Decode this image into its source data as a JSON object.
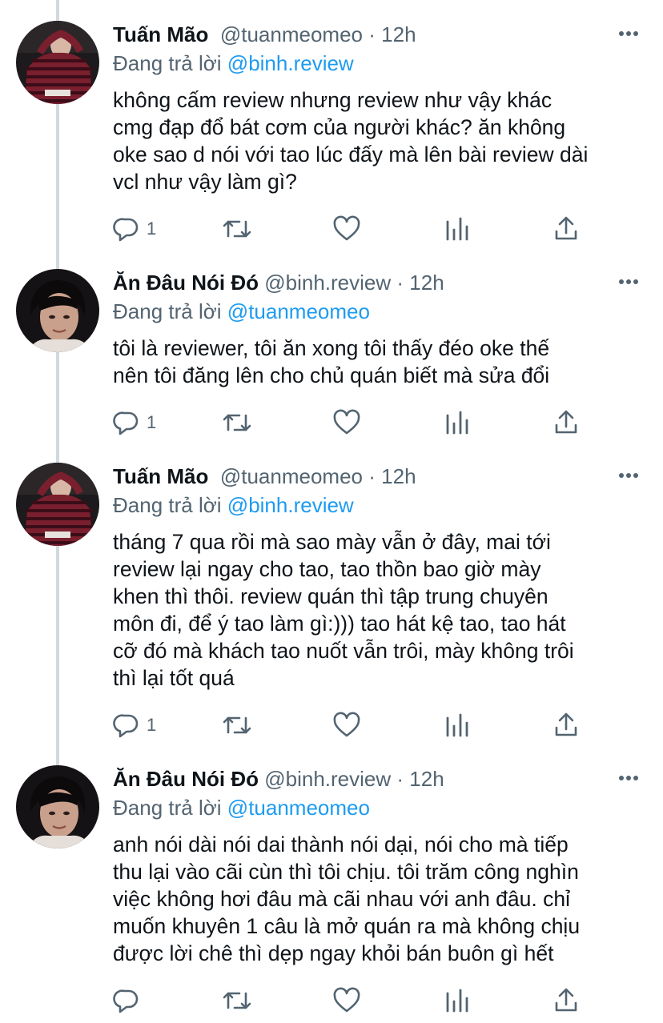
{
  "tweets": [
    {
      "name": "Tuấn Mão",
      "handle": "@tuanmeomeo",
      "time": "12h",
      "reply_prefix": "Đang trả lời",
      "reply_to": "@binh.review",
      "lines": [
        "không cấm review nhưng review như vậy khác",
        "cmg đạp đổ bát cơm của người khác? ăn không",
        "oke sao d nói với tao lúc đấy mà lên bài review dài",
        "vcl như vậy làm gì?"
      ],
      "reply_count": "1",
      "avatar": "user-striped-sweater"
    },
    {
      "name": "Ăn Đâu Nói Đó",
      "handle": "@binh.review",
      "time": "12h",
      "reply_prefix": "Đang trả lời",
      "reply_to": "@tuanmeomeo",
      "lines": [
        "tôi là reviewer, tôi ăn xong tôi thấy đéo oke thế",
        "nên tôi đăng lên cho chủ quán biết mà sửa đổi"
      ],
      "reply_count": "1",
      "avatar": "user-dark-portrait"
    },
    {
      "name": "Tuấn Mão",
      "handle": "@tuanmeomeo",
      "time": "12h",
      "reply_prefix": "Đang trả lời",
      "reply_to": "@binh.review",
      "lines": [
        "tháng 7 qua rồi mà sao mày vẫn ở đây, mai tới",
        "review lại ngay cho tao, tao thồn bao giờ mày",
        "khen thì thôi. review quán thì tập trung chuyên",
        "môn đi, để ý tao làm gì:))) tao hát kệ tao, tao hát",
        "cỡ đó mà khách tao nuốt vẫn trôi, mày không trôi",
        "thì lại tốt quá"
      ],
      "reply_count": "1",
      "avatar": "user-striped-sweater"
    },
    {
      "name": "Ăn Đâu Nói Đó",
      "handle": "@binh.review",
      "time": "12h",
      "reply_prefix": "Đang trả lời",
      "reply_to": "@tuanmeomeo",
      "lines": [
        "anh nói dài nói dai thành nói dại, nói cho mà tiếp",
        "thu lại vào cãi cùn thì tôi chịu. tôi trăm công nghìn",
        "việc không hơi đâu mà cãi nhau với anh đâu. chỉ",
        "muốn khuyên 1 câu là mở quán ra mà không chịu",
        "được lời chê thì dẹp ngay khỏi bán buôn gì hết"
      ],
      "reply_count": "",
      "avatar": "user-dark-portrait"
    }
  ],
  "colors": {
    "text": "#0f1419",
    "secondary": "#536471",
    "link": "#1d9bf0",
    "thread_line": "#cfd9de"
  }
}
